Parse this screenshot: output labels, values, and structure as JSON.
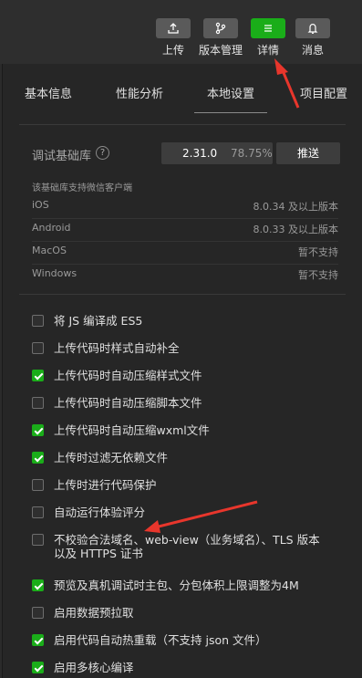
{
  "toolbar": {
    "buttons": [
      {
        "label": "上传",
        "icon": "upload-icon"
      },
      {
        "label": "版本管理",
        "icon": "branch-icon"
      },
      {
        "label": "详情",
        "icon": "list-icon",
        "active": true
      },
      {
        "label": "消息",
        "icon": "bell-icon"
      }
    ]
  },
  "tabs": [
    {
      "label": "基本信息"
    },
    {
      "label": "性能分析"
    },
    {
      "label": "本地设置",
      "active": true
    },
    {
      "label": "项目配置"
    }
  ],
  "base_library": {
    "label": "调试基础库",
    "help": "?",
    "version": "2.31.0",
    "usage": "78.75%",
    "push_label": "推送"
  },
  "support": {
    "title": "该基础库支持微信客户端",
    "rows": [
      {
        "os": "iOS",
        "req": "8.0.34 及以上版本"
      },
      {
        "os": "Android",
        "req": "8.0.33 及以上版本"
      },
      {
        "os": "MacOS",
        "req": "暂不支持"
      },
      {
        "os": "Windows",
        "req": "暂不支持"
      }
    ]
  },
  "options": [
    {
      "label": "将 JS 编译成 ES5",
      "checked": false
    },
    {
      "label": "上传代码时样式自动补全",
      "checked": false
    },
    {
      "label": "上传代码时自动压缩样式文件",
      "checked": true
    },
    {
      "label": "上传代码时自动压缩脚本文件",
      "checked": false
    },
    {
      "label": "上传代码时自动压缩wxml文件",
      "checked": true
    },
    {
      "label": "上传时过滤无依赖文件",
      "checked": true
    },
    {
      "label": "上传时进行代码保护",
      "checked": false
    },
    {
      "label": "自动运行体验评分",
      "checked": false
    },
    {
      "label": "不校验合法域名、web-view（业务域名）、TLS 版本以及 HTTPS 证书",
      "checked": false
    },
    {
      "label": "预览及真机调试时主包、分包体积上限调整为4M",
      "checked": true
    },
    {
      "label": "启用数据预拉取",
      "checked": false
    },
    {
      "label": "启用代码自动热重载（不支持 json 文件）",
      "checked": true
    },
    {
      "label": "启用多核心编译",
      "checked": true
    }
  ],
  "colors": {
    "accent": "#1aad19",
    "annotation_arrow": "#e8362c"
  }
}
